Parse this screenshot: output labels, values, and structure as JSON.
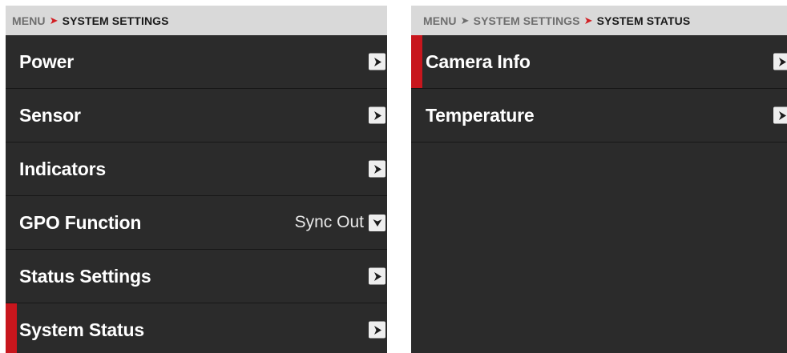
{
  "left_panel": {
    "breadcrumb": [
      {
        "text": "MENU",
        "current": false
      },
      {
        "text": "SYSTEM SETTINGS",
        "current": true
      }
    ],
    "separator": "➤",
    "items": [
      {
        "label": "Power",
        "value": "",
        "icon": "chevron-right-icon",
        "selected": false
      },
      {
        "label": "Sensor",
        "value": "",
        "icon": "chevron-right-icon",
        "selected": false
      },
      {
        "label": "Indicators",
        "value": "",
        "icon": "chevron-right-icon",
        "selected": false
      },
      {
        "label": "GPO Function",
        "value": "Sync Out",
        "icon": "chevron-down-icon",
        "selected": false
      },
      {
        "label": "Status Settings",
        "value": "",
        "icon": "chevron-right-icon",
        "selected": false
      },
      {
        "label": "System Status",
        "value": "",
        "icon": "chevron-right-icon",
        "selected": true
      }
    ]
  },
  "right_panel": {
    "breadcrumb": [
      {
        "text": "MENU",
        "current": false
      },
      {
        "text": "SYSTEM SETTINGS",
        "current": false
      },
      {
        "text": "SYSTEM STATUS",
        "current": true
      }
    ],
    "separator": "➤",
    "items": [
      {
        "label": "Camera Info",
        "value": "",
        "icon": "chevron-right-icon",
        "selected": true
      },
      {
        "label": "Temperature",
        "value": "",
        "icon": "chevron-right-icon",
        "selected": false
      }
    ]
  },
  "colors": {
    "panel_background": "#2b2b2b",
    "breadcrumb_background": "#d9d9d9",
    "accent_red": "#c8161d",
    "text_primary": "#ffffff"
  }
}
